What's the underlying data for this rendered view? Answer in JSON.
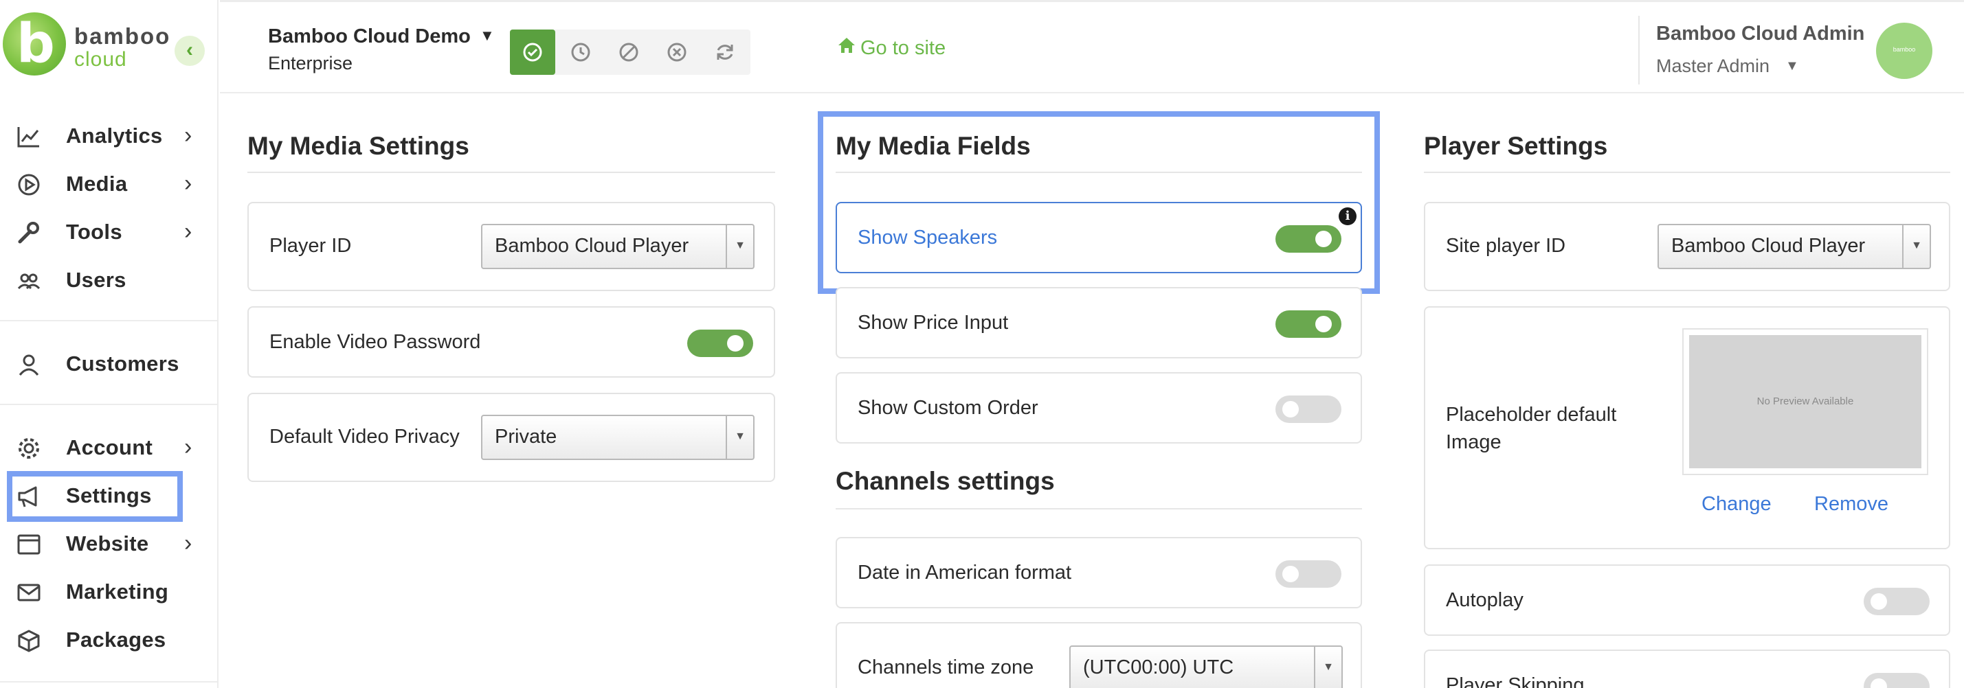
{
  "sidebar": {
    "logo": {
      "line1": "bamboo",
      "line2": "cloud"
    },
    "collapse_glyph": "‹",
    "items": [
      {
        "label": "Analytics",
        "icon": "chart-line-icon",
        "has_chevron": true
      },
      {
        "label": "Media",
        "icon": "play-circle-icon",
        "has_chevron": true
      },
      {
        "label": "Tools",
        "icon": "wrench-icon",
        "has_chevron": true
      },
      {
        "label": "Users",
        "icon": "users-icon",
        "has_chevron": false
      },
      {
        "label": "Customers",
        "icon": "user-icon",
        "has_chevron": false
      },
      {
        "label": "Account",
        "icon": "gear-icon",
        "has_chevron": true
      },
      {
        "label": "Settings",
        "icon": "megaphone-icon",
        "has_chevron": false,
        "active": true
      },
      {
        "label": "Website",
        "icon": "browser-window-icon",
        "has_chevron": true
      },
      {
        "label": "Marketing",
        "icon": "envelope-icon",
        "has_chevron": false
      },
      {
        "label": "Packages",
        "icon": "box-icon",
        "has_chevron": false
      }
    ]
  },
  "header": {
    "site_name": "Bamboo Cloud Demo",
    "site_plan": "Enterprise",
    "status_buttons": [
      {
        "icon": "check-circle-icon",
        "active": true
      },
      {
        "icon": "clock-icon",
        "active": false
      },
      {
        "icon": "ban-icon",
        "active": false
      },
      {
        "icon": "x-circle-icon",
        "active": false
      },
      {
        "icon": "refresh-icon",
        "active": false
      }
    ],
    "goto_label": "Go to site",
    "user_name": "Bamboo Cloud Admin",
    "user_role": "Master Admin"
  },
  "my_media_settings": {
    "title": "My Media Settings",
    "player_id_label": "Player ID",
    "player_id_value": "Bamboo Cloud Player",
    "enable_password_label": "Enable Video Password",
    "enable_password_on": true,
    "privacy_label": "Default Video Privacy",
    "privacy_value": "Private"
  },
  "my_media_fields": {
    "title": "My Media Fields",
    "fields": [
      {
        "label": "Show Speakers",
        "on": true
      },
      {
        "label": "Show Price Input",
        "on": true
      },
      {
        "label": "Show Custom Order",
        "on": false
      }
    ]
  },
  "channels_settings": {
    "title": "Channels settings",
    "date_format_label": "Date in American format",
    "date_format_on": false,
    "timezone_label": "Channels time zone",
    "timezone_value": "(UTC00:00) UTC"
  },
  "player_settings": {
    "title": "Player Settings",
    "site_player_label": "Site player ID",
    "site_player_value": "Bamboo Cloud Player",
    "placeholder_label": "Placeholder default Image",
    "preview_text": "No Preview Available",
    "change_label": "Change",
    "remove_label": "Remove",
    "autoplay_label": "Autoplay",
    "autoplay_on": false,
    "player_skipping_label": "Player Skipping",
    "player_skipping_on": false
  },
  "colors": {
    "brand_green": "#6aa84f",
    "link_blue": "#3b78d8",
    "highlight_blue": "#7ba0f2"
  }
}
